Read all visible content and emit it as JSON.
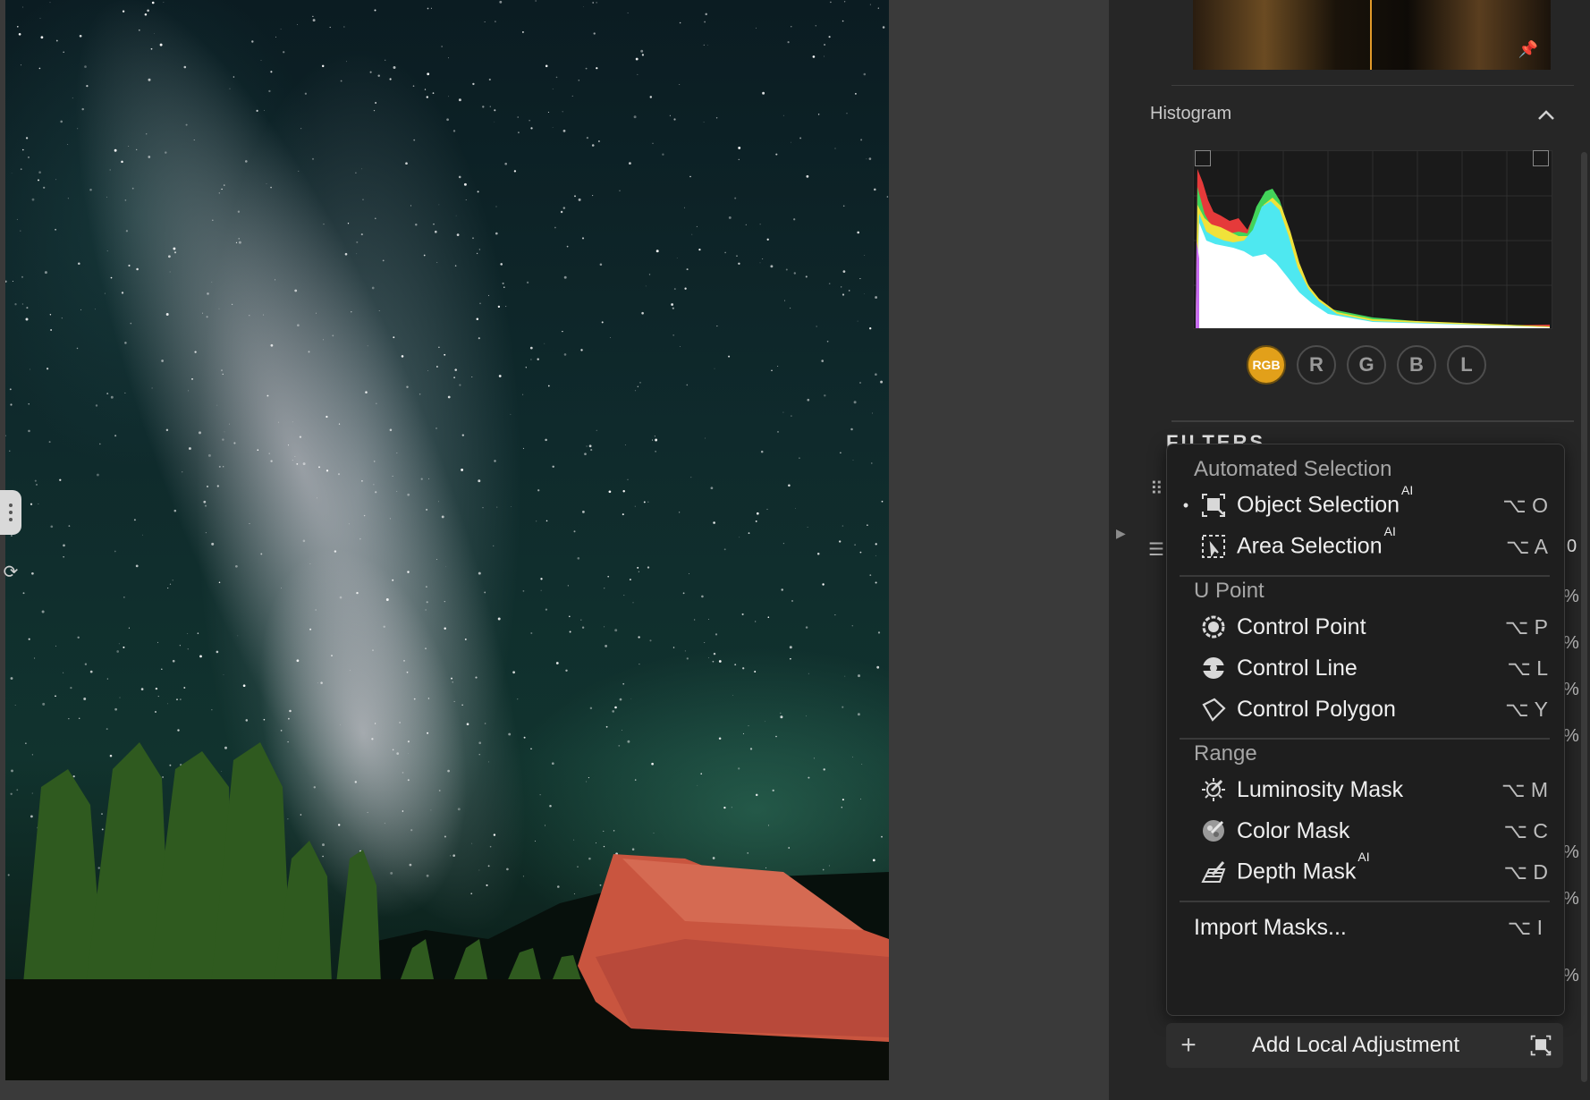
{
  "histogram": {
    "title": "Histogram",
    "channels": [
      "RGB",
      "R",
      "G",
      "B",
      "L"
    ],
    "active_channel": "RGB",
    "accent_color": "#e2a01a"
  },
  "filters": {
    "title": "FILTERS"
  },
  "menu": {
    "sections": [
      {
        "title": "Automated Selection",
        "items": [
          {
            "label": "Object Selection",
            "ai": "AI",
            "shortcut": "⌥ O",
            "icon": "object-selection-icon",
            "selected": true
          },
          {
            "label": "Area Selection",
            "ai": "AI",
            "shortcut": "⌥ A",
            "icon": "area-selection-icon"
          }
        ]
      },
      {
        "title": "U Point",
        "items": [
          {
            "label": "Control Point",
            "shortcut": "⌥ P",
            "icon": "control-point-icon"
          },
          {
            "label": "Control Line",
            "shortcut": "⌥ L",
            "icon": "control-line-icon"
          },
          {
            "label": "Control Polygon",
            "shortcut": "⌥ Y",
            "icon": "control-polygon-icon"
          }
        ]
      },
      {
        "title": "Range",
        "items": [
          {
            "label": "Luminosity Mask",
            "shortcut": "⌥ M",
            "icon": "luminosity-mask-icon"
          },
          {
            "label": "Color Mask",
            "shortcut": "⌥ C",
            "icon": "color-mask-icon"
          },
          {
            "label": "Depth Mask",
            "ai": "AI",
            "shortcut": "⌥ D",
            "icon": "depth-mask-icon"
          }
        ]
      }
    ],
    "import": {
      "label": "Import Masks...",
      "shortcut": "⌥ I"
    }
  },
  "add_adjustment": {
    "plus": "+",
    "label": "Add Local Adjustment"
  },
  "background_percent": [
    "%",
    "%",
    "%",
    "%",
    "%",
    "%",
    "%"
  ],
  "background_value": "0"
}
